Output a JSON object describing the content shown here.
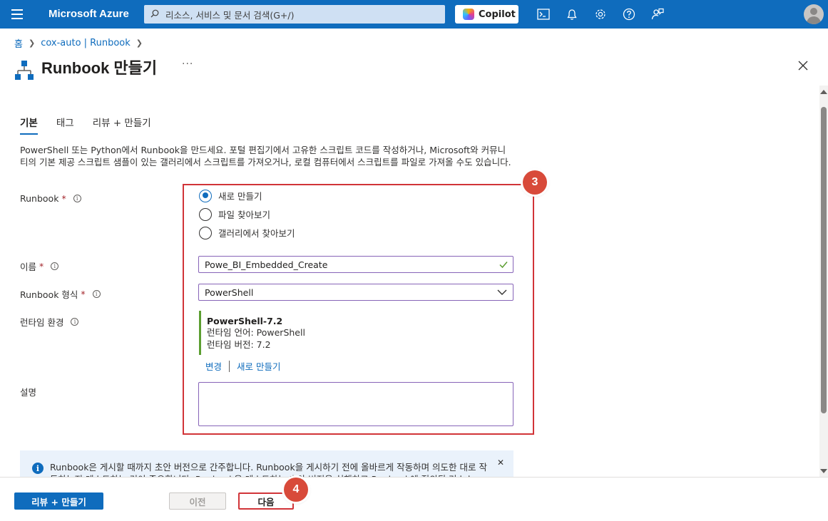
{
  "topbar": {
    "brand": "Microsoft Azure",
    "search_placeholder": "리소스, 서비스 및 문서 검색(G+/)",
    "copilot_label": "Copilot"
  },
  "breadcrumb": {
    "home": "홈",
    "parent": "cox-auto | Runbook"
  },
  "page": {
    "title": "Runbook 만들기",
    "more": "···"
  },
  "tabs": [
    {
      "label": "기본",
      "active": true
    },
    {
      "label": "태그",
      "active": false
    },
    {
      "label": "리뷰 + 만들기",
      "active": false
    }
  ],
  "description": "PowerShell 또는 Python에서 Runbook을 만드세요. 포털 편집기에서 고유한 스크립트 코드를 작성하거나, Microsoft와 커뮤니티의 기본 제공 스크립트 샘플이 있는 갤러리에서 스크립트를 가져오거나, 로컬 컴퓨터에서 스크립트를 파일로 가져올 수도 있습니다.",
  "form": {
    "runbook_label": "Runbook",
    "required_mark": "*",
    "info_glyph": "i",
    "radio_options": [
      {
        "label": "새로 만들기",
        "checked": true
      },
      {
        "label": "파일 찾아보기",
        "checked": false
      },
      {
        "label": "갤러리에서 찾아보기",
        "checked": false
      }
    ],
    "name_label": "이름",
    "name_value": "Powe_BI_Embedded_Create",
    "type_label": "Runbook 형식",
    "type_value": "PowerShell",
    "runtime_label": "런타임 환경",
    "runtime": {
      "name": "PowerShell-7.2",
      "language": "런타임 언어: PowerShell",
      "version": "런타임 버전: 7.2",
      "change_link": "변경",
      "new_link": "새로 만들기"
    },
    "description_label": "설명"
  },
  "annotations": {
    "badge3": "3",
    "badge4": "4"
  },
  "infobar": {
    "glyph": "i",
    "text": "Runbook은 게시할 때까지 초안 버전으로 간주합니다. Runbook을 게시하기 전에 올바르게 작동하며 의도한 대로 작동하는지 테스트하는 것이 중요합니다. Runbook을 테스트하는 초안 버전을 실행하고 Runbook에 정의된 리소스",
    "close": "✕"
  },
  "footer": {
    "review_create": "리뷰 + 만들기",
    "previous": "이전",
    "next": "다음"
  },
  "colors": {
    "azure_blue": "#0f6cbd",
    "annotation_red": "#d13438",
    "runtime_green": "#5c9e31",
    "input_border": "#8764b8"
  }
}
